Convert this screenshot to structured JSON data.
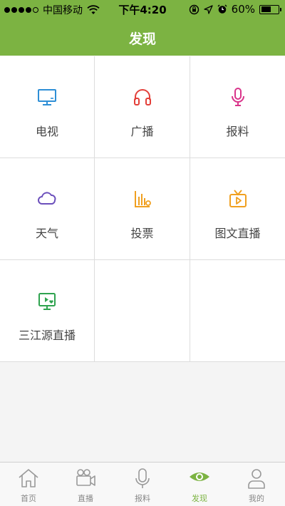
{
  "status_bar": {
    "carrier": "中国移动",
    "time": "下午4:20",
    "battery_text": "60%",
    "battery_level": 0.6
  },
  "nav": {
    "title": "发现"
  },
  "grid": {
    "items": [
      {
        "label": "电视",
        "icon": "tv-icon",
        "color": "#2e8fd6"
      },
      {
        "label": "广播",
        "icon": "headphones-icon",
        "color": "#e3403a"
      },
      {
        "label": "报料",
        "icon": "microphone-icon",
        "color": "#d9348a"
      },
      {
        "label": "天气",
        "icon": "cloud-icon",
        "color": "#6b4fbb"
      },
      {
        "label": "投票",
        "icon": "poll-chart-icon",
        "color": "#f0a020"
      },
      {
        "label": "图文直播",
        "icon": "live-tv-icon",
        "color": "#f0a020"
      },
      {
        "label": "三江源直播",
        "icon": "live-monitor-heart-icon",
        "color": "#2fa34f"
      }
    ]
  },
  "tabs": [
    {
      "label": "首页",
      "icon": "home-icon"
    },
    {
      "label": "直播",
      "icon": "video-camera-icon"
    },
    {
      "label": "报料",
      "icon": "microphone-icon"
    },
    {
      "label": "发现",
      "icon": "eye-icon",
      "active": true
    },
    {
      "label": "我的",
      "icon": "user-icon"
    }
  ],
  "colors": {
    "accent": "#7cb342",
    "inactive": "#888888"
  }
}
